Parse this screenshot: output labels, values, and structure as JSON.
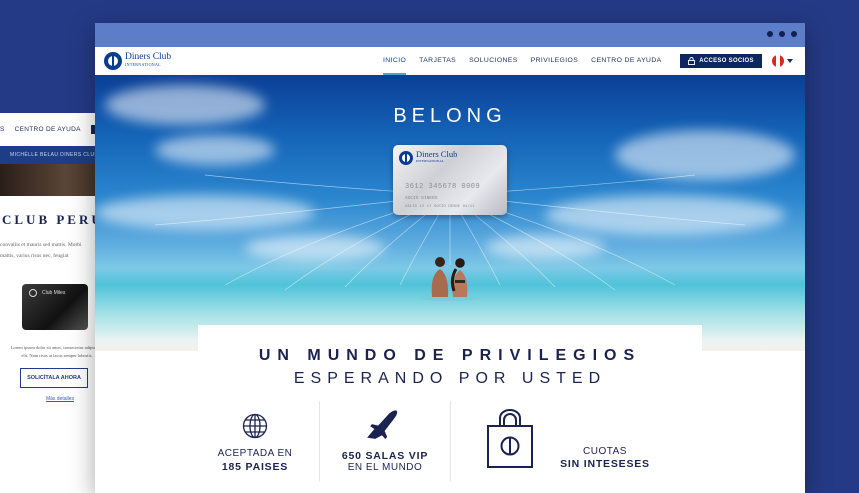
{
  "back_window": {
    "nav_items": [
      "S",
      "CENTRO DE AYUDA"
    ],
    "banner_text": "MICHÈLLE BELAU DINERS CLUB",
    "title": "CLUB PERÚ",
    "text_lines": [
      "convallis et mauris sed mattis. Morbi",
      "mattis, varius risus nec, feugiat"
    ],
    "card_label": "Club Miles",
    "lorem": "Lorem ipsum dolor sit amet, consectetur adipiscing elit. Nam risus at lacus semper lobortis.",
    "cta_label": "SOLICÍTALA AHORA",
    "link_label": "Más detalles"
  },
  "front_window": {
    "logo": {
      "line1": "Diners Club",
      "line2": "INTERNATIONAL"
    },
    "menu": [
      {
        "label": "INICIO",
        "active": true
      },
      {
        "label": "TARJETAS",
        "active": false
      },
      {
        "label": "SOLUCIONES",
        "active": false
      },
      {
        "label": "PRIVILEGIOS",
        "active": false
      },
      {
        "label": "CENTRO DE AYUDA",
        "active": false
      }
    ],
    "acceso_label": "ACCESO SOCIOS",
    "hero": {
      "title": "BELONG",
      "card": {
        "brand_line1": "Diners Club",
        "brand_line2": "INTERNATIONAL",
        "number": "3612 345678 0009",
        "name": "SOCIO DINERS",
        "valid": "VALID 12 17 SOCIO DESDE 01/11"
      }
    },
    "tagline": {
      "line1": "UN MUNDO DE PRIVILEGIOS",
      "line2": "ESPERANDO POR USTED"
    },
    "features": [
      {
        "icon": "globe-icon",
        "line1": "ACEPTADA EN",
        "line2": "185 PAISES"
      },
      {
        "icon": "airplane-icon",
        "line1": "650 SALAS VIP",
        "line2": "EN EL MUNDO"
      },
      {
        "icon": "shopping-bag-icon",
        "line1": "",
        "line2": ""
      },
      {
        "icon": "",
        "line1": "CUOTAS",
        "line2": "SIN INTESESES"
      }
    ]
  },
  "colors": {
    "background": "#243a86",
    "navy": "#1a2350",
    "accent": "#4aa3df",
    "button": "#0c2660",
    "titlebar": "#5d7dc9"
  }
}
